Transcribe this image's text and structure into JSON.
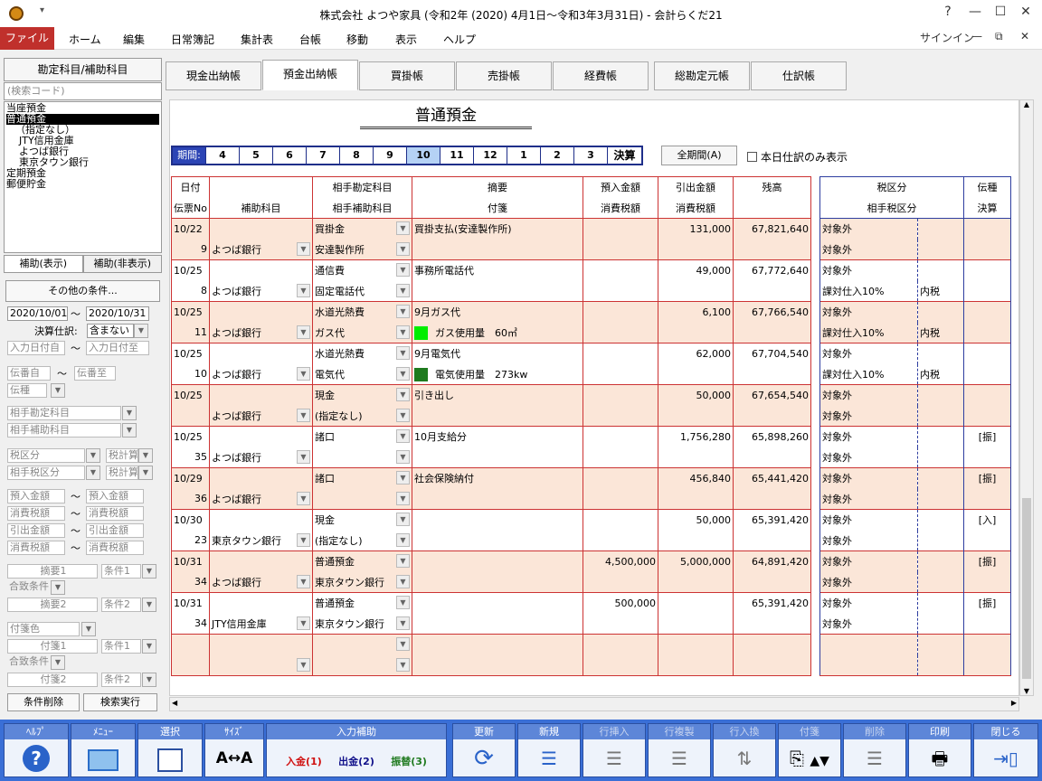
{
  "window": {
    "title": "株式会社 よつや家具 (令和2年 (2020) 4月1日～令和3年3月31日) - 会計らくだ21",
    "help": "?",
    "minimize": "—",
    "maximize": "☐",
    "close": "✕"
  },
  "menu": {
    "file": "ファイル",
    "items": [
      "ホーム",
      "編集",
      "日常簿記",
      "集計表",
      "台帳",
      "移動",
      "表示",
      "ヘルプ"
    ],
    "signin": "サインイン"
  },
  "left": {
    "header": "勘定科目/補助科目",
    "search_placeholder": "(検索コード)",
    "tree": [
      "当座預金",
      "普通預金",
      "（指定なし）",
      "JTY信用金庫",
      "よつば銀行",
      "東京タウン銀行",
      "定期預金",
      "郵便貯金"
    ],
    "tab_show": "補助(表示)",
    "tab_hide": "補助(非表示)",
    "other_conditions": "その他の条件...",
    "date_from": "2020/10/01",
    "date_to": "2020/10/31",
    "tilde": "〜",
    "settle_label": "決算仕訳:",
    "settle_value": "含まない",
    "input_from": "入力日付自",
    "input_to": "入力日付至",
    "slip_from": "伝番自",
    "slip_to": "伝番至",
    "slip_kind": "伝種",
    "partner_account": "相手勘定科目",
    "partner_sub": "相手補助科目",
    "tax_class": "税区分",
    "tax_calc": "税計算",
    "partner_tax": "相手税区分",
    "tax_calc2": "税計算",
    "deposit1": "預入金額",
    "deposit2": "預入金額",
    "tax1": "消費税額",
    "tax2": "消費税額",
    "withdraw1": "引出金額",
    "withdraw2": "引出金額",
    "tax3": "消費税額",
    "tax4": "消費税額",
    "memo1": "摘要1",
    "cond1": "条件1",
    "match_cond": "合致条件",
    "memo2": "摘要2",
    "cond2": "条件2",
    "tag_color": "付箋色",
    "tag1": "付箋1",
    "cond3": "条件1",
    "match_cond2": "合致条件",
    "tag2": "付箋2",
    "cond4": "条件2",
    "clear_btn": "条件削除",
    "search_btn": "検索実行"
  },
  "tabs": [
    "現金出納帳",
    "預金出納帳",
    "買掛帳",
    "売掛帳",
    "経費帳",
    "総勘定元帳",
    "仕訳帳"
  ],
  "sheet": {
    "title": "普通預金",
    "period_label": "期間:",
    "periods": [
      "4",
      "5",
      "6",
      "7",
      "8",
      "9",
      "10",
      "11",
      "12",
      "1",
      "2",
      "3"
    ],
    "kessan": "決算",
    "all_period": "全期間(A)",
    "today_only": "本日仕訳のみ表示",
    "headers_row1": [
      "日付",
      "",
      "相手勘定科目",
      "摘要",
      "預入金額",
      "引出金額",
      "残高",
      "税区分",
      "",
      "伝種"
    ],
    "headers_row2": [
      "伝票No",
      "補助科目",
      "相手補助科目",
      "付箋",
      "消費税額",
      "消費税額",
      "",
      "相手税区分",
      "",
      "決算"
    ],
    "rows": [
      {
        "date": "10/22",
        "no": "9",
        "sub": "よつば銀行",
        "acct": "買掛金",
        "psub": "安達製作所",
        "memo": "買掛支払(安達製作所)",
        "tag": "",
        "tagcolor": "",
        "dep": "",
        "wd": "131,000",
        "bal": "67,821,640",
        "tax": "対象外",
        "ptax": "対象外",
        "pincl": "",
        "kind": ""
      },
      {
        "date": "10/25",
        "no": "8",
        "sub": "よつば銀行",
        "acct": "通信費",
        "psub": "固定電話代",
        "memo": "事務所電話代",
        "tag": "",
        "tagcolor": "",
        "dep": "",
        "wd": "49,000",
        "bal": "67,772,640",
        "tax": "対象外",
        "ptax": "課対仕入10%",
        "pincl": "内税",
        "kind": ""
      },
      {
        "date": "10/25",
        "no": "11",
        "sub": "よつば銀行",
        "acct": "水道光熱費",
        "psub": "ガス代",
        "memo": "9月ガス代",
        "tag": "ガス使用量　60㎥",
        "tagcolor": "#00ee00",
        "dep": "",
        "wd": "6,100",
        "bal": "67,766,540",
        "tax": "対象外",
        "ptax": "課対仕入10%",
        "pincl": "内税",
        "kind": ""
      },
      {
        "date": "10/25",
        "no": "10",
        "sub": "よつば銀行",
        "acct": "水道光熱費",
        "psub": "電気代",
        "memo": "9月電気代",
        "tag": "電気使用量　273kw",
        "tagcolor": "#1e7a1e",
        "dep": "",
        "wd": "62,000",
        "bal": "67,704,540",
        "tax": "対象外",
        "ptax": "課対仕入10%",
        "pincl": "内税",
        "kind": ""
      },
      {
        "date": "10/25",
        "no": "",
        "sub": "よつば銀行",
        "acct": "現金",
        "psub": "(指定なし)",
        "memo": "引き出し",
        "tag": "",
        "tagcolor": "",
        "dep": "",
        "wd": "50,000",
        "bal": "67,654,540",
        "tax": "対象外",
        "ptax": "対象外",
        "pincl": "",
        "kind": ""
      },
      {
        "date": "10/25",
        "no": "35",
        "sub": "よつば銀行",
        "acct": "諸口",
        "psub": "",
        "memo": "10月支給分",
        "tag": "",
        "tagcolor": "",
        "dep": "",
        "wd": "1,756,280",
        "bal": "65,898,260",
        "tax": "対象外",
        "ptax": "対象外",
        "pincl": "",
        "kind": "[振]"
      },
      {
        "date": "10/29",
        "no": "36",
        "sub": "よつば銀行",
        "acct": "諸口",
        "psub": "",
        "memo": "社会保険納付",
        "tag": "",
        "tagcolor": "",
        "dep": "",
        "wd": "456,840",
        "bal": "65,441,420",
        "tax": "対象外",
        "ptax": "対象外",
        "pincl": "",
        "kind": "[振]"
      },
      {
        "date": "10/30",
        "no": "23",
        "sub": "東京タウン銀行",
        "acct": "現金",
        "psub": "(指定なし)",
        "memo": "",
        "tag": "",
        "tagcolor": "",
        "dep": "",
        "wd": "50,000",
        "bal": "65,391,420",
        "tax": "対象外",
        "ptax": "対象外",
        "pincl": "",
        "kind": "[入]"
      },
      {
        "date": "10/31",
        "no": "34",
        "sub": "よつば銀行",
        "acct": "普通預金",
        "psub": "東京タウン銀行",
        "memo": "",
        "tag": "",
        "tagcolor": "",
        "dep": "4,500,000",
        "wd": "5,000,000",
        "bal": "64,891,420",
        "tax": "対象外",
        "ptax": "対象外",
        "pincl": "",
        "kind": "[振]"
      },
      {
        "date": "10/31",
        "no": "34",
        "sub": "JTY信用金庫",
        "acct": "普通預金",
        "psub": "東京タウン銀行",
        "memo": "",
        "tag": "",
        "tagcolor": "",
        "dep": "500,000",
        "wd": "",
        "bal": "65,391,420",
        "tax": "対象外",
        "ptax": "対象外",
        "pincl": "",
        "kind": "[振]"
      },
      {
        "date": "",
        "no": "",
        "sub": "",
        "acct": "",
        "psub": "",
        "memo": "",
        "tag": "",
        "tagcolor": "",
        "dep": "",
        "wd": "",
        "bal": "",
        "tax": "",
        "ptax": "",
        "pincl": "",
        "kind": ""
      }
    ]
  },
  "toolbar": {
    "help": "ﾍﾙﾌﾟ",
    "menu": "ﾒﾆｭｰ",
    "select": "選択",
    "size": "ｻｲｽﾞ",
    "input_assist": "入力補助",
    "nyukin": "入金(1)",
    "shukkin": "出金(2)",
    "furikae": "振替(3)",
    "update": "更新",
    "new": "新規",
    "row_insert": "行挿入",
    "row_copy": "行複製",
    "row_swap": "行入換",
    "tag": "付箋",
    "delete": "削除",
    "print": "印刷",
    "close": "閉じる",
    "colors": {
      "bar": "#3a6fd6",
      "nyukin": "#d01010",
      "shukkin": "#10108a",
      "furikae": "#1f7a1f"
    }
  }
}
